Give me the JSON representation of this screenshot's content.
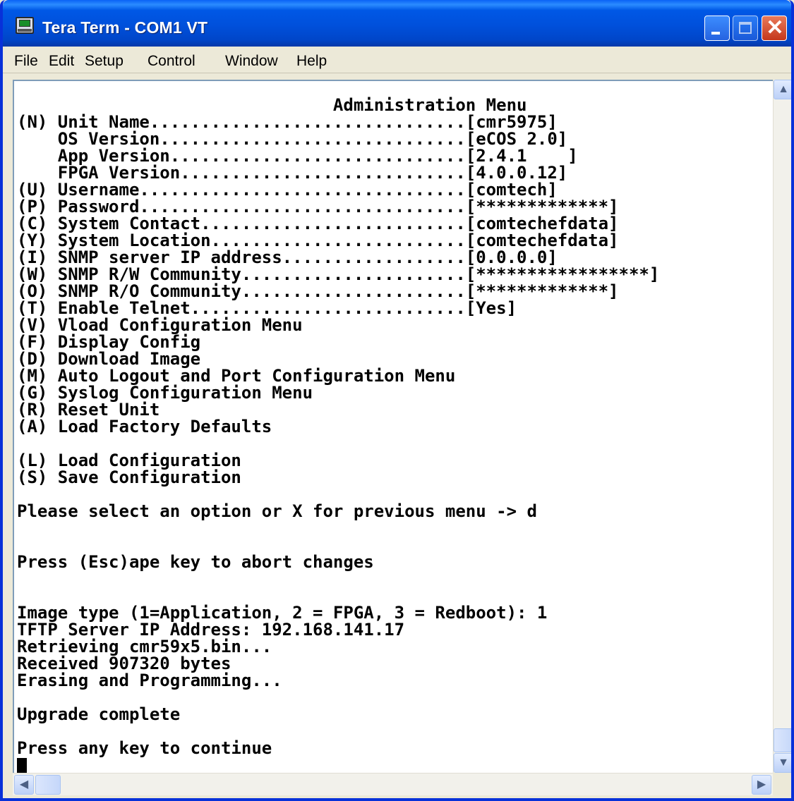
{
  "window": {
    "title": "Tera Term - COM1 VT",
    "colors": {
      "titlebar": "#0055e5",
      "terminal_bg": "#ffffff",
      "terminal_fg": "#000000"
    }
  },
  "menu": [
    "File",
    "Edit",
    "Setup",
    "Control",
    "Window",
    "Help"
  ],
  "terminal": {
    "lines": [
      "                               Administration Menu",
      "(N) Unit Name...............................[cmr5975]",
      "    OS Version..............................[eCOS 2.0]",
      "    App Version.............................[2.4.1    ]",
      "    FPGA Version............................[4.0.0.12]",
      "(U) Username................................[comtech]",
      "(P) Password................................[*************]",
      "(C) System Contact..........................[comtechefdata]",
      "(Y) System Location.........................[comtechefdata]",
      "(I) SNMP server IP address..................[0.0.0.0]",
      "(W) SNMP R/W Community......................[*****************]",
      "(O) SNMP R/O Community......................[*************]",
      "(T) Enable Telnet...........................[Yes]",
      "(V) Vload Configuration Menu",
      "(F) Display Config",
      "(D) Download Image",
      "(M) Auto Logout and Port Configuration Menu",
      "(G) Syslog Configuration Menu",
      "(R) Reset Unit",
      "(A) Load Factory Defaults",
      "",
      "(L) Load Configuration",
      "(S) Save Configuration",
      "",
      "Please select an option or X for previous menu -> d",
      "",
      "",
      "Press (Esc)ape key to abort changes",
      "",
      "",
      "Image type (1=Application, 2 = FPGA, 3 = Redboot): 1",
      "TFTP Server IP Address: 192.168.141.17",
      "Retrieving cmr59x5.bin...",
      "Received 907320 bytes",
      "Erasing and Programming...",
      "",
      "Upgrade complete",
      "",
      "Press any key to continue"
    ]
  },
  "scrollbar": {
    "vertical_position": 1.0,
    "horizontal_position": 0.0
  }
}
